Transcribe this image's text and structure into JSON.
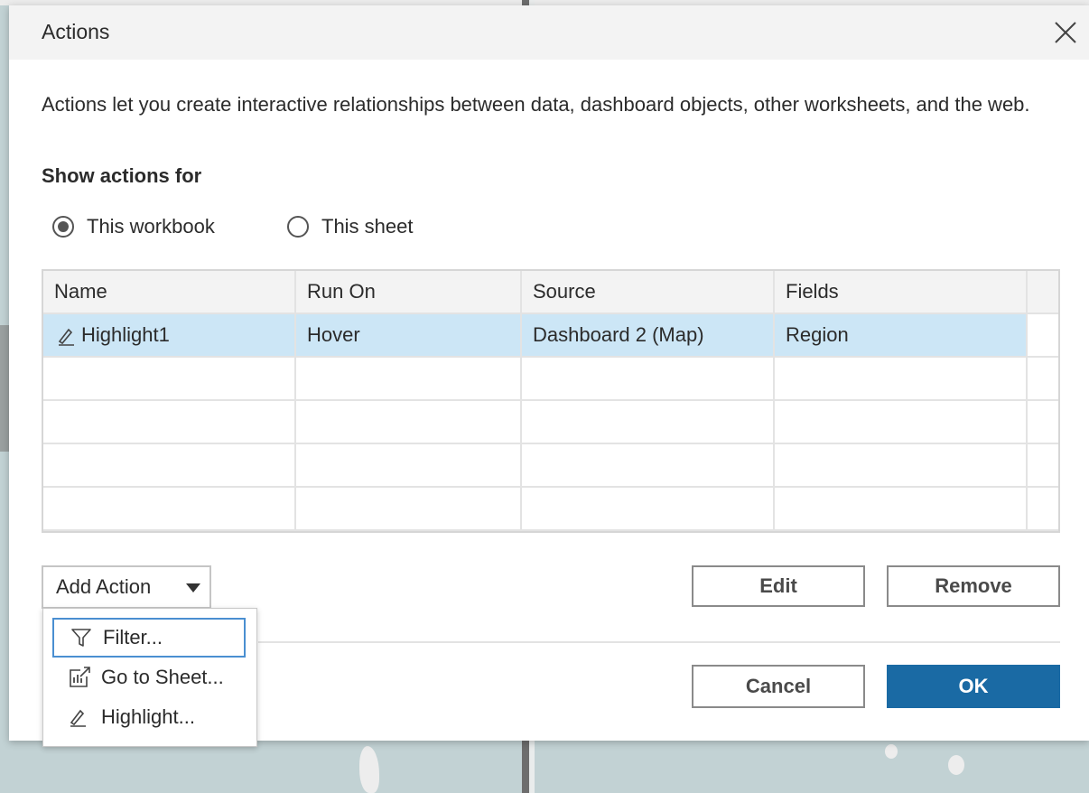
{
  "dialog": {
    "title": "Actions",
    "description": "Actions let you create interactive relationships between data, dashboard objects, other worksheets, and the web.",
    "show_actions_label": "Show actions for",
    "radio_options": [
      {
        "label": "This workbook",
        "selected": true
      },
      {
        "label": "This sheet",
        "selected": false
      }
    ]
  },
  "table": {
    "columns": [
      "Name",
      "Run On",
      "Source",
      "Fields"
    ],
    "rows": [
      {
        "name": "Highlight1",
        "run_on": "Hover",
        "source": "Dashboard 2 (Map)",
        "fields": "Region",
        "icon": "highlight-pen-icon",
        "selected": true
      }
    ]
  },
  "buttons": {
    "add_action": "Add Action",
    "edit": "Edit",
    "remove": "Remove",
    "cancel": "Cancel",
    "ok": "OK"
  },
  "add_action_menu": {
    "items": [
      {
        "label": "Filter...",
        "icon": "filter-icon",
        "focused": true
      },
      {
        "label": "Go to Sheet...",
        "icon": "go-to-sheet-icon",
        "focused": false
      },
      {
        "label": "Highlight...",
        "icon": "highlight-pen-icon",
        "focused": false
      }
    ]
  },
  "colors": {
    "accent": "#1a6aa4",
    "selected_row": "#cce6f6",
    "focus_border": "#4a8fd1"
  }
}
